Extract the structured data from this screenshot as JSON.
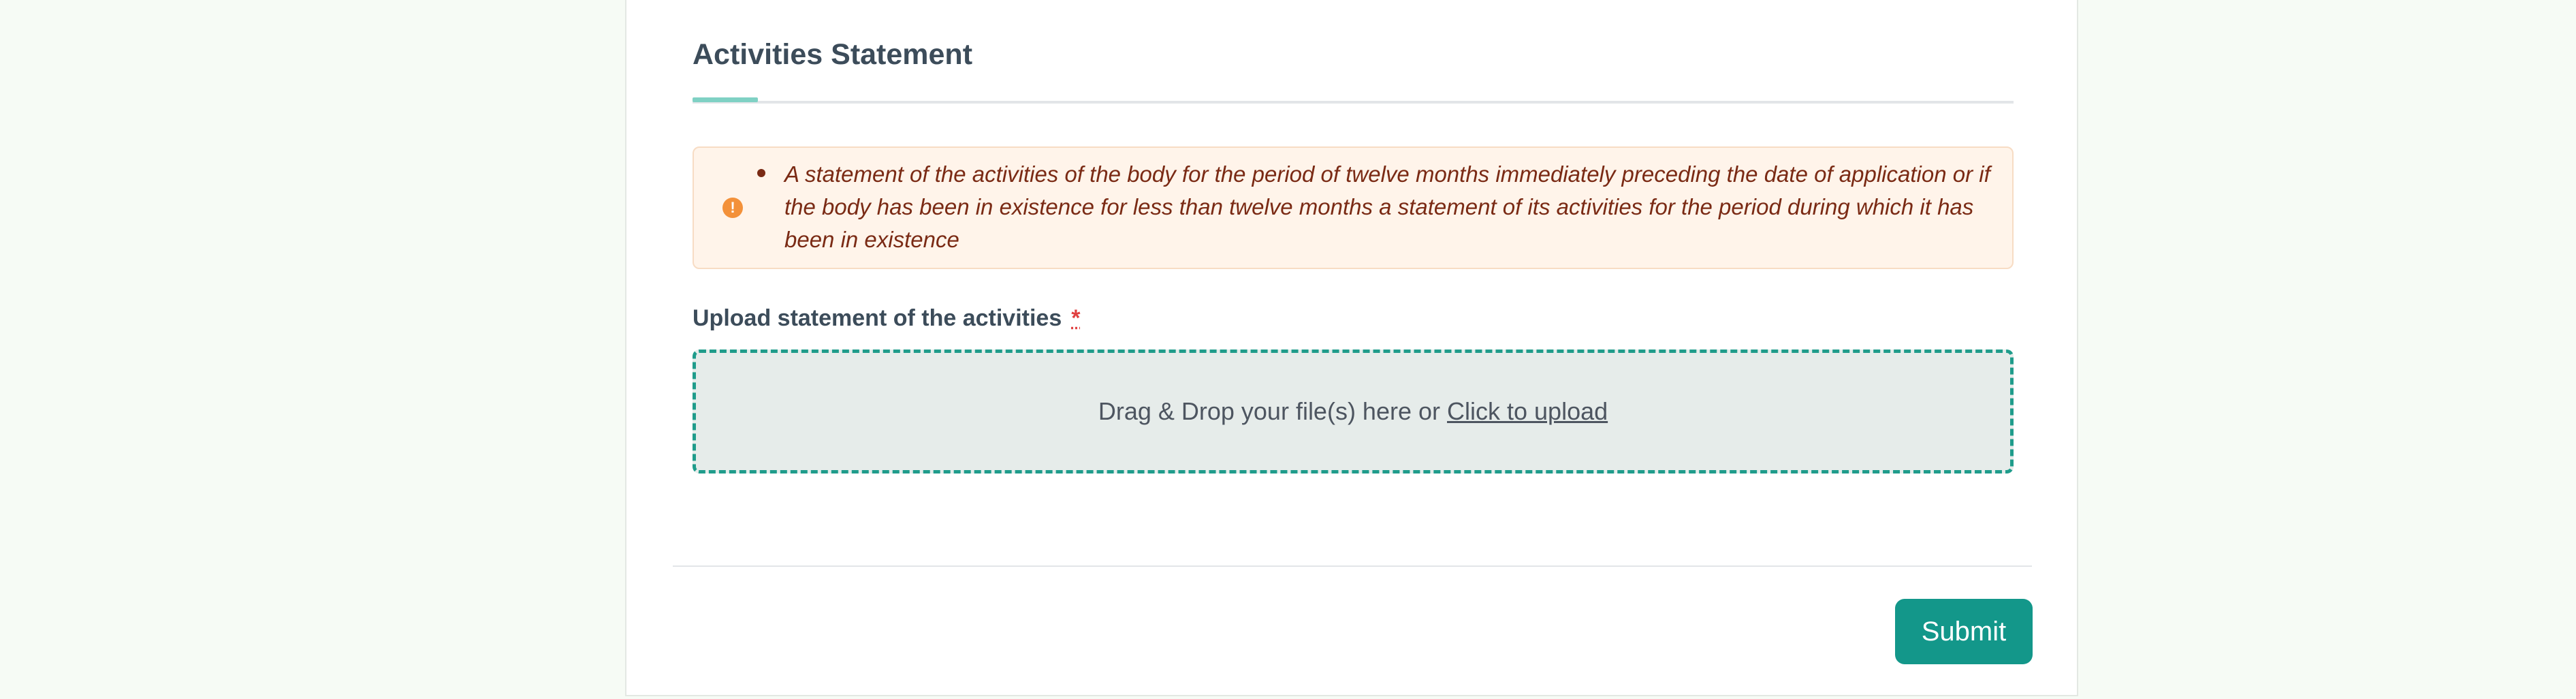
{
  "section": {
    "title": "Activities Statement"
  },
  "alert": {
    "icon": "exclamation-circle-icon",
    "icon_glyph": "!",
    "icon_color": "#f3913a",
    "bullet_text": "A statement of the activities of the body for the period of twelve months immediately preceding the date of application or if the body has been in existence for less than twelve months a statement of its activities for the period during which it has been in existence"
  },
  "upload": {
    "label": "Upload statement of the activities",
    "required_marker": "*",
    "dropzone_text": "Drag & Drop your file(s) here or",
    "dropzone_link": "Click to upload",
    "border_color": "#1f9c8b"
  },
  "form": {
    "submit_label": "Submit",
    "submit_color": "#13978a"
  }
}
